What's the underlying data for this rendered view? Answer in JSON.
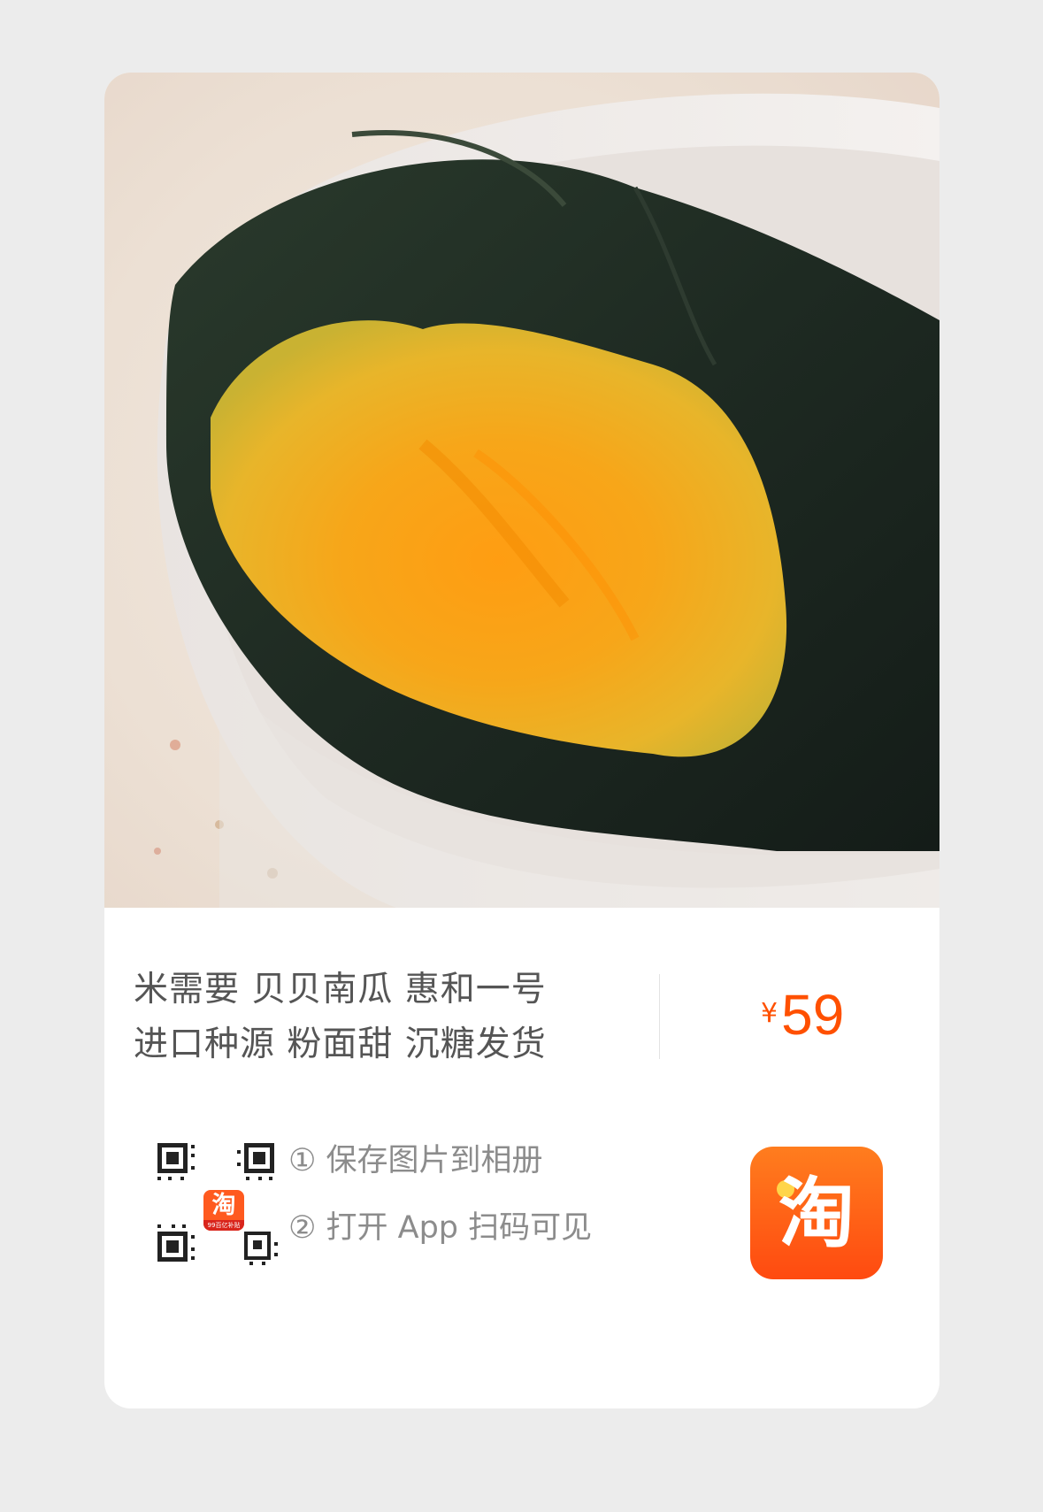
{
  "product": {
    "title_line1": "米需要 贝贝南瓜 惠和一号",
    "title_line2": "进口种源 粉面甜 沉糖发货",
    "currency": "¥",
    "price": "59"
  },
  "instructions": {
    "step1": "① 保存图片到相册",
    "step2": "② 打开 App 扫码可见"
  },
  "qr_badge": {
    "icon": "taobao-logo-icon",
    "glyph": "淘",
    "caption": "99百亿补贴"
  },
  "app_icon": {
    "icon": "taobao-app-icon",
    "glyph": "淘"
  },
  "colors": {
    "accent": "#ff5000",
    "background": "#ececec",
    "card": "#ffffff"
  }
}
